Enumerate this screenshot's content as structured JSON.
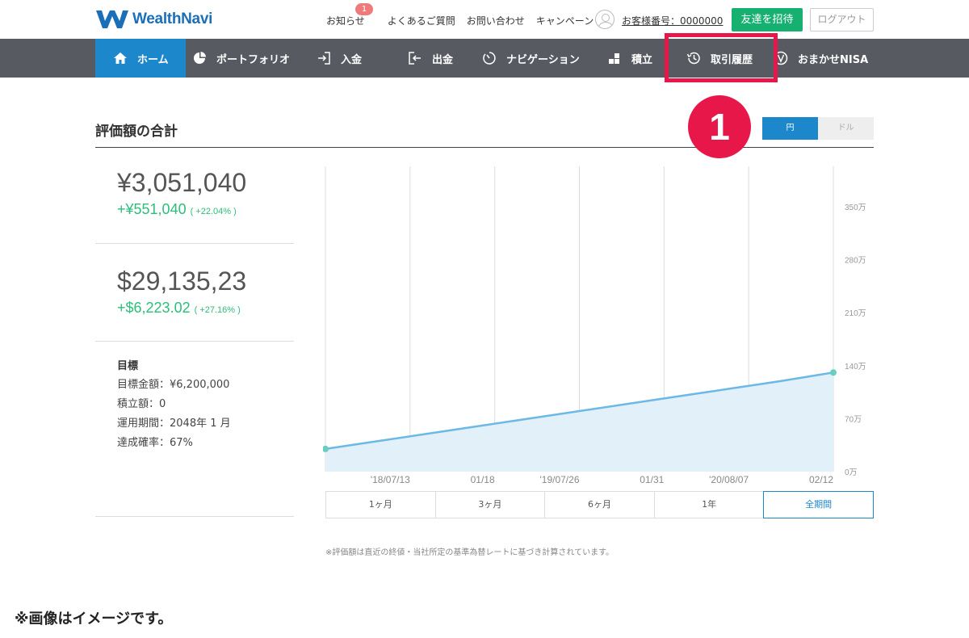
{
  "header": {
    "logo_text": "WealthNavi",
    "links": [
      "お知らせ",
      "よくあるご質問",
      "お問い合わせ",
      "キャンペーン"
    ],
    "notification_count": "1",
    "customer_number": "お客様番号：0000000",
    "invite_label": "友達を招待",
    "logout_label": "ログアウト"
  },
  "nav": {
    "items": [
      {
        "label": "ホーム",
        "icon": "home-icon"
      },
      {
        "label": "ポートフォリオ",
        "icon": "pie-chart-icon"
      },
      {
        "label": "入金",
        "icon": "deposit-icon"
      },
      {
        "label": "出金",
        "icon": "withdraw-icon"
      },
      {
        "label": "ナビゲーション",
        "icon": "gauge-icon"
      },
      {
        "label": "積立",
        "icon": "blocks-icon"
      },
      {
        "label": "取引履歴",
        "icon": "history-icon"
      },
      {
        "label": "おまかせNISA",
        "icon": "nisa-icon"
      }
    ],
    "active_index": 0,
    "highlighted_index": 6
  },
  "annotation": {
    "step_number": "1",
    "color": "#e8174a"
  },
  "section": {
    "title": "評価額の合計",
    "currency_yen": "円",
    "currency_usd": "ドル"
  },
  "summary": {
    "yen_total": "¥3,051,040",
    "yen_gain": "+¥551,040",
    "yen_gain_pct": "( +22.04% )",
    "usd_total": "$29,135,23",
    "usd_gain": "+$6,223.02",
    "usd_gain_pct": "( +27.16% )"
  },
  "goal": {
    "title": "目標",
    "amount": "目標金額：¥6,200,000",
    "monthly": "積立額：0",
    "period": "運用期間：2048年 1 月",
    "probability": "達成確率：67%"
  },
  "chart_data": {
    "type": "area",
    "x_tick_labels": [
      "'18/07/13",
      "01/18",
      "'19/07/26",
      "01/31",
      "'20/08/07",
      "02/12"
    ],
    "y_tick_labels": [
      "0万",
      "70万",
      "140万",
      "210万",
      "280万",
      "350万"
    ],
    "y_ticks": [
      0,
      70,
      140,
      210,
      280,
      350
    ],
    "ylim": [
      0,
      350
    ],
    "series": [
      {
        "values": [
          [
            0,
            30
          ],
          [
            0.1,
            40
          ],
          [
            0.2,
            50
          ],
          [
            0.3,
            60
          ],
          [
            0.4,
            70
          ],
          [
            0.5,
            80
          ],
          [
            0.6,
            90
          ],
          [
            0.7,
            100
          ],
          [
            0.75,
            105
          ],
          [
            0.8,
            110
          ],
          [
            0.85,
            115
          ],
          [
            0.9,
            120
          ],
          [
            1.0,
            131
          ]
        ]
      }
    ],
    "line_color": "#6cb8e6",
    "fill_color": "#e2f0fa",
    "grid": true
  },
  "periods": {
    "items": [
      "1ヶ月",
      "3ヶ月",
      "6ヶ月",
      "1年",
      "全期間"
    ],
    "active_index": 4
  },
  "footnote": "※評価額は直近の終値・当社所定の基準為替レートに基づき計算されています。",
  "caption": "※画像はイメージです。"
}
